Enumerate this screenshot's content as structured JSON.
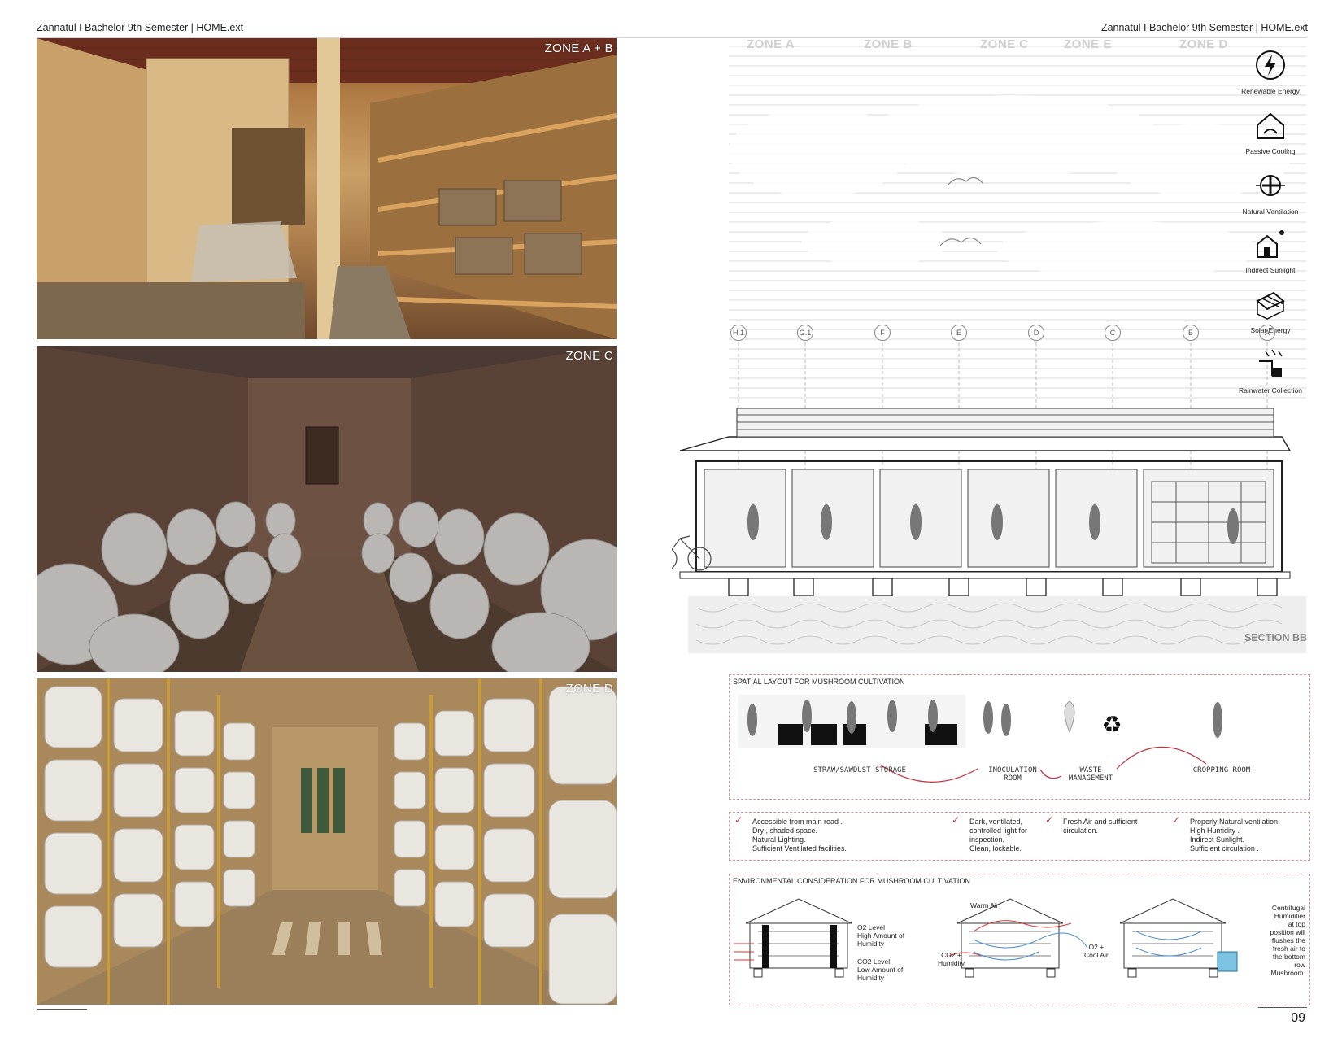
{
  "header": {
    "left": "Zannatul I Bachelor 9th Semester | HOME.ext",
    "right": "Zannatul I Bachelor 9th Semester | HOME.ext"
  },
  "photos": [
    {
      "zone": "ZONE A + B"
    },
    {
      "zone": "ZONE C"
    },
    {
      "zone": "ZONE D"
    }
  ],
  "section": {
    "zones": [
      "ZONE A",
      "ZONE B",
      "ZONE C",
      "ZONE E",
      "ZONE D"
    ],
    "grid": [
      "H.1",
      "G.1",
      "F",
      "E",
      "D",
      "C",
      "B",
      "A"
    ],
    "label": "SECTION BB",
    "features": [
      {
        "label": "Renewable Energy",
        "icon": "lightning-icon"
      },
      {
        "label": "Passive Cooling",
        "icon": "house-cooling-icon"
      },
      {
        "label": "Natural Ventilation",
        "icon": "fan-icon"
      },
      {
        "label": "Indirect Sunlight",
        "icon": "sun-house-icon"
      },
      {
        "label": "Solar Energy",
        "icon": "solar-panel-icon"
      },
      {
        "label": "Rainwater Collection",
        "icon": "rain-tank-icon"
      }
    ]
  },
  "spatial": {
    "title": "SPATIAL LAYOUT FOR MUSHROOM CULTIVATION",
    "stages": [
      "STRAW/SAWDUST STORAGE",
      "INOCULATION ROOM",
      "WASTE MANAGEMENT",
      "CROPPING ROOM"
    ]
  },
  "criteria": [
    {
      "lines": [
        "Accessible from main road .",
        "Dry , shaded space.",
        "",
        "Natural Lighting.",
        "Sufficient Ventilated facilities."
      ]
    },
    {
      "lines": [
        "Dark, ventilated,",
        "controlled light for",
        "inspection.",
        "Clean, lockable."
      ]
    },
    {
      "lines": [
        "Fresh Air and sufficient",
        "circulation."
      ]
    },
    {
      "lines": [
        "Properly Natural ventilation.",
        "High Humidity .",
        "Indirect Sunlight.",
        "Sufficient circulation ."
      ]
    }
  ],
  "environment": {
    "title": "ENVIRONMENTAL CONSIDERATION  FOR MUSHROOM CULTIVATION",
    "labels": {
      "o2": [
        "O2 Level",
        "High Amount of",
        "Humidity"
      ],
      "co2": [
        "CO2 Level",
        "Low Amount of",
        "Humidity"
      ],
      "warm": "Warm Air",
      "co2h": [
        "CO2 +",
        "Humidity"
      ],
      "o2c": [
        "O2 +",
        "Cool Air"
      ],
      "humid": [
        "Centrifugal",
        "Humidifier",
        "at top",
        "position will",
        "flushes the",
        "fresh air to",
        "the bottom",
        "row",
        "Mushroom."
      ]
    }
  },
  "page": "09"
}
